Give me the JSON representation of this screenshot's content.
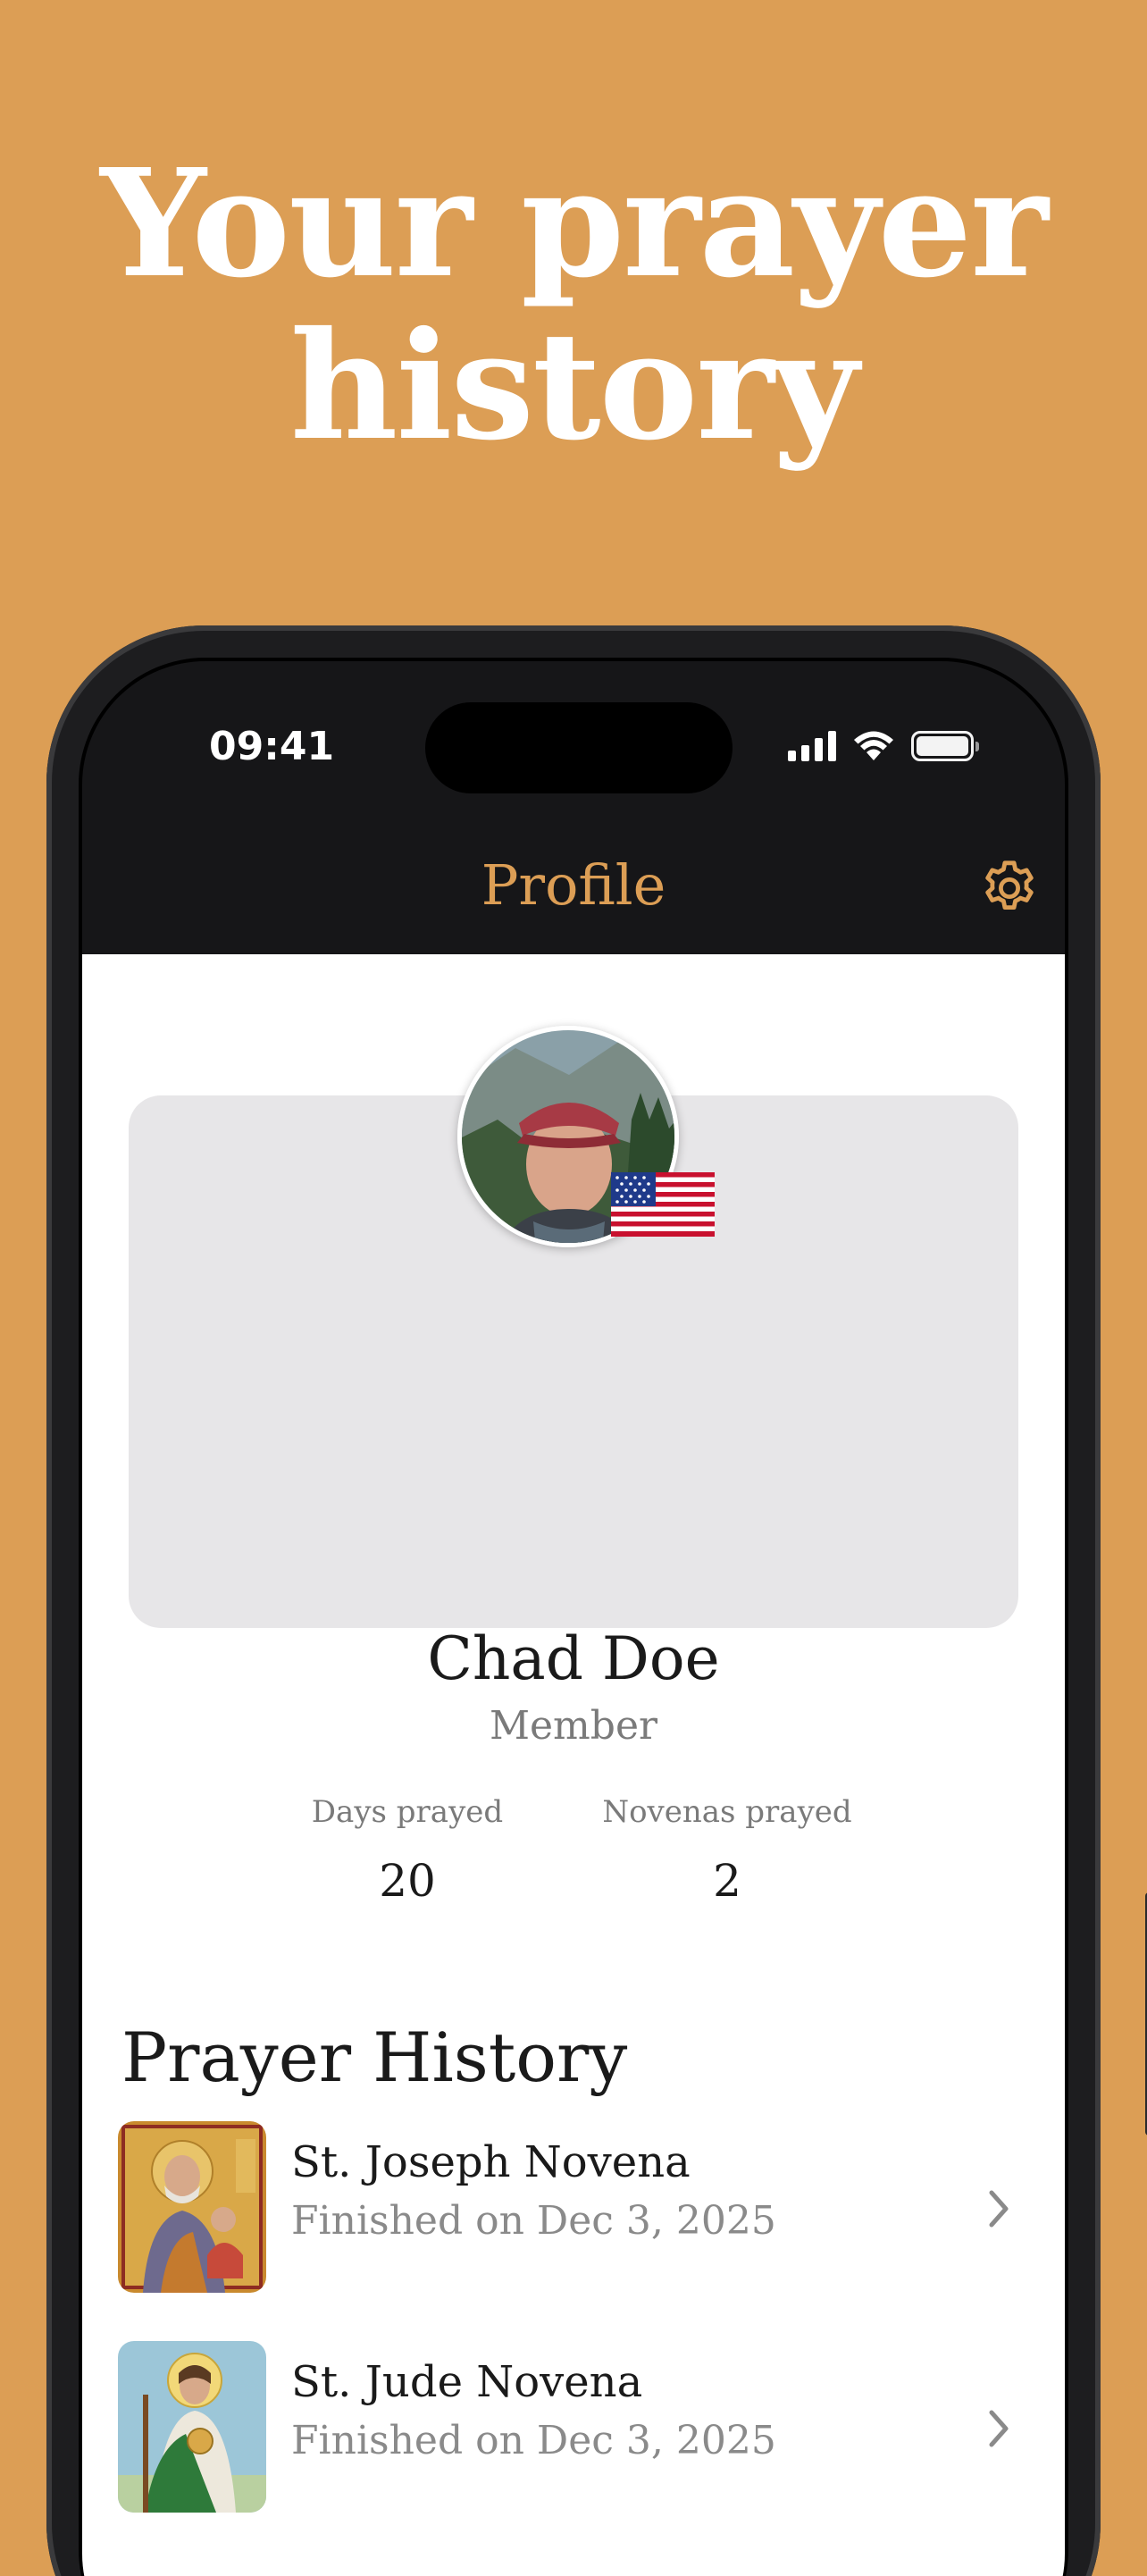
{
  "headline": {
    "line1": "Your prayer",
    "line2": "history"
  },
  "status_bar": {
    "time": "09:41"
  },
  "nav": {
    "title": "Profile",
    "settings_icon": "gear-icon"
  },
  "profile": {
    "name": "Chad Doe",
    "role": "Member",
    "flag_icon": "us-flag-icon",
    "stats": [
      {
        "label": "Days prayed",
        "value": "20"
      },
      {
        "label": "Novenas prayed",
        "value": "2"
      }
    ]
  },
  "history": {
    "title": "Prayer History",
    "items": [
      {
        "title": "St. Joseph Novena",
        "subtitle": "Finished on Dec 3, 2025"
      },
      {
        "title": "St. Jude Novena",
        "subtitle": "Finished on Dec 3, 2025"
      }
    ]
  },
  "colors": {
    "accent": "#DC9E55",
    "header_bg": "#161618",
    "card_bg": "#E7E6E8"
  }
}
